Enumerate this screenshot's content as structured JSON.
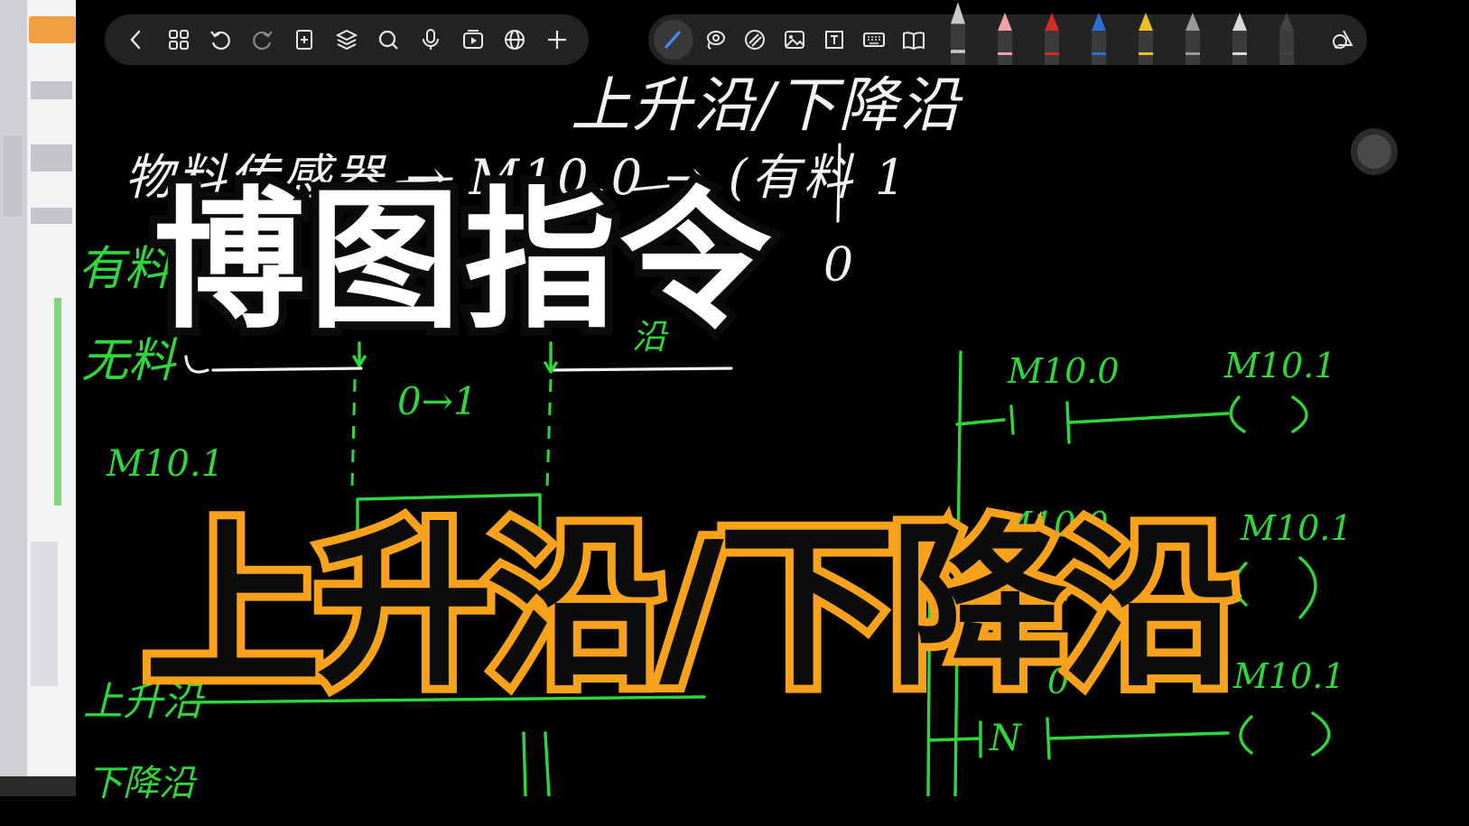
{
  "toolbar_left": {
    "icons": [
      "back-icon",
      "grid-icon",
      "undo-icon",
      "redo-icon",
      "add-page-icon",
      "layers-icon",
      "search-icon",
      "microphone-icon",
      "media-icon",
      "globe-icon",
      "plus-icon"
    ]
  },
  "toolbar_right": {
    "icons": [
      "pen-tool-icon",
      "lasso-icon",
      "eraser-icon",
      "image-icon",
      "text-box-icon",
      "keyboard-icon",
      "book-icon",
      "shape-recognition-icon"
    ],
    "pen_colors": [
      "#c9c9c9",
      "#f2a0a8",
      "#d42a2a",
      "#2a6fd4",
      "#f0c020",
      "#9a9a9a",
      "#d8d8d8",
      "#444444"
    ]
  },
  "handwriting": {
    "heading": "上升沿/下降沿",
    "sensor_line": "物料传感器 → M10.0 → (有料 1",
    "zero_right": "0",
    "has_material": "有料",
    "no_material": "无料",
    "rising_mark": "沿",
    "zero_to_one": "0→1",
    "m101_left": "M10.1",
    "rising_edge_label": "上升沿",
    "falling_edge_label": "下降沿",
    "ladder": {
      "row1_contact": "M10.0",
      "row1_coil": "M10.1",
      "row2_contact": "M10.0",
      "row2_coil": "M10.1",
      "row3_contact": "0",
      "row3_coil": "M10.1",
      "row3_instruction": "N"
    }
  },
  "overlay": {
    "title_line1": "博图指令",
    "title_line2": "上升沿/下降沿"
  },
  "colors": {
    "background": "#000000",
    "ink_white": "#f2f2f2",
    "ink_green": "#2ed83a",
    "title_white": "#ffffff",
    "title_outline_orange": "#f7a21a"
  }
}
